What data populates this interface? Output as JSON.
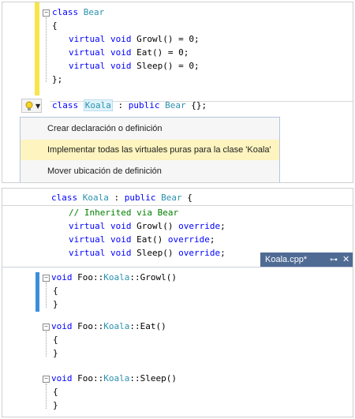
{
  "code_top": {
    "class_bear": "class Bear",
    "kw_class": "class",
    "name_bear": "Bear",
    "open_brace": "{",
    "methods": [
      {
        "kw1": "virtual",
        "kw2": "void",
        "rest": "Growl() = 0;"
      },
      {
        "kw1": "virtual",
        "kw2": "void",
        "rest": "Eat() = 0;"
      },
      {
        "kw1": "virtual",
        "kw2": "void",
        "rest": "Sleep() = 0;"
      }
    ],
    "close_brace": "};",
    "koala_line": {
      "kw_class": "class",
      "name": "Koala",
      "colon": ":",
      "kw_public": "public",
      "base": "Bear",
      "tail": "{};"
    }
  },
  "quick_actions": {
    "icon": "lightbulb-icon",
    "items": [
      {
        "label": "Crear declaración o definición"
      },
      {
        "label": "Implementar todas las virtuales puras para la clase 'Koala'"
      },
      {
        "label": "Mover ubicación de definición"
      }
    ],
    "selected_index": 1
  },
  "code_preview": {
    "koala_decl": {
      "kw_class": "class",
      "name": "Koala",
      "colon": ":",
      "kw_public": "public",
      "base": "Bear",
      "brace": "{"
    },
    "comment": "// Inherited via Bear",
    "overrides": [
      {
        "kw1": "virtual",
        "kw2": "void",
        "name": "Growl()",
        "kw3": "override",
        "semi": ";"
      },
      {
        "kw1": "virtual",
        "kw2": "void",
        "name": "Eat()",
        "kw3": "override",
        "semi": ";"
      },
      {
        "kw1": "virtual",
        "kw2": "void",
        "name": "Sleep()",
        "kw3": "override",
        "semi": ";"
      }
    ]
  },
  "file_tab": {
    "name": "Koala.cpp*",
    "pin_icon": "pin-icon",
    "close_icon": "close-icon"
  },
  "definitions": [
    {
      "kw": "void",
      "ns": "Foo::",
      "cls": "Koala",
      "sep": "::",
      "fn": "Growl()",
      "open": "{",
      "close": "}"
    },
    {
      "kw": "void",
      "ns": "Foo::",
      "cls": "Koala",
      "sep": "::",
      "fn": "Eat()",
      "open": "{",
      "close": "}"
    },
    {
      "kw": "void",
      "ns": "Foo::",
      "cls": "Koala",
      "sep": "::",
      "fn": "Sleep()",
      "open": "{",
      "close": "}"
    }
  ],
  "colors": {
    "keyword": "#0000ff",
    "type": "#2b91af",
    "comment": "#008000",
    "change_bar": "#f7e54a",
    "tab_bg": "#4f6b94",
    "selected_item": "#fdf4bf"
  }
}
